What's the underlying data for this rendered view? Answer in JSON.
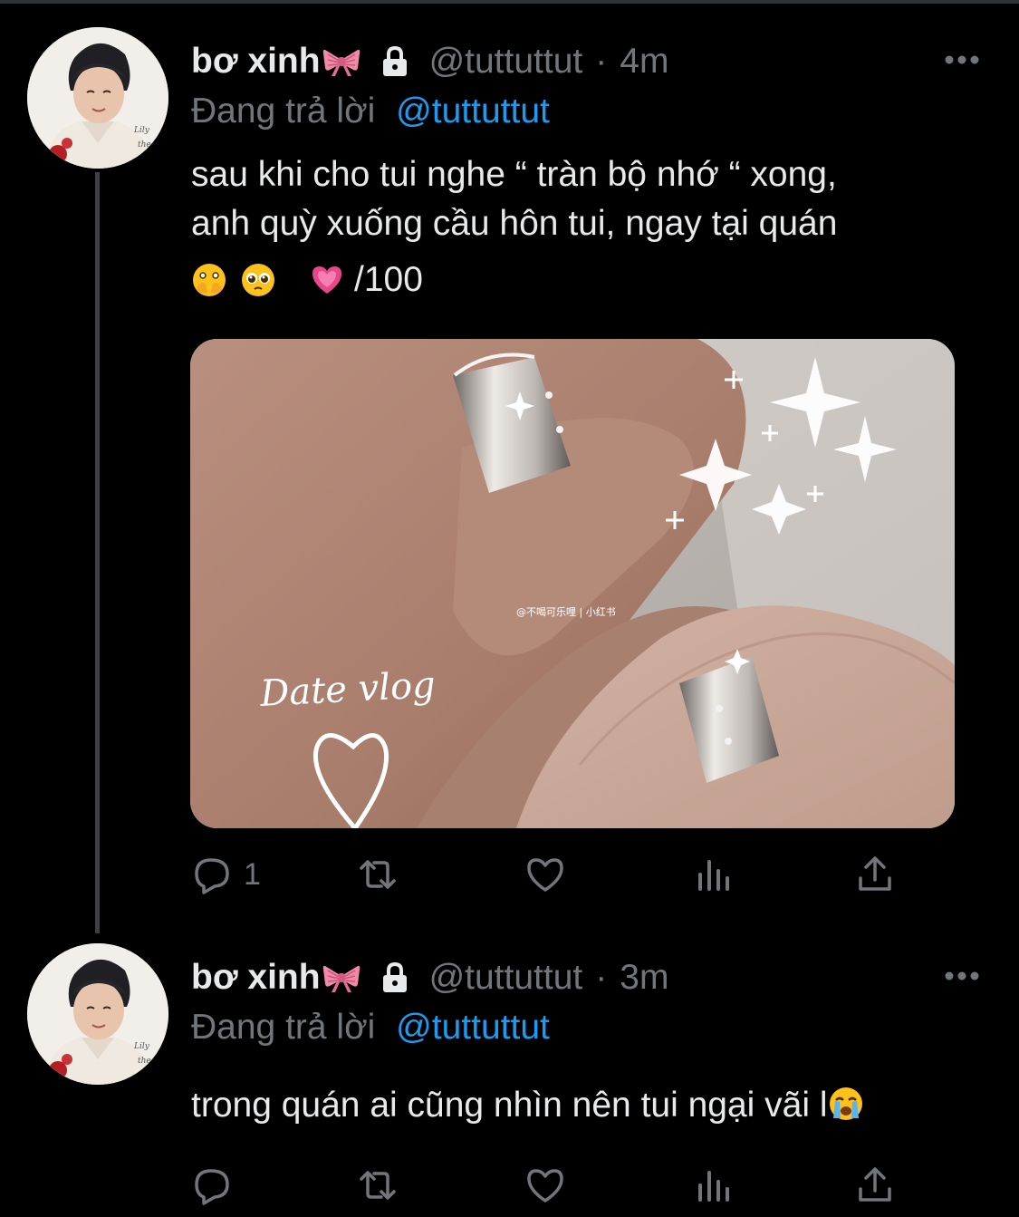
{
  "colors": {
    "background": "#000000",
    "text": "#e7e9ea",
    "muted": "#71767b",
    "link": "#1d9bf0",
    "thread_line": "#3e4144"
  },
  "tweets": [
    {
      "display_name": "bơ xinh",
      "name_icon": "ribbon-bow",
      "protected_icon": "lock-icon",
      "handle": "@tuttuttut",
      "separator": "·",
      "time": "4m",
      "reply_prefix": "Đang trả lời",
      "reply_to": "@tuttuttut",
      "text_lines": [
        "sau khi cho tui nghe “ tràn bộ nhớ “ xong,",
        "anh quỳ xuống cầu hôn tui, ngay tại quán"
      ],
      "emoji_suffix": "/100",
      "emojis": [
        "face-with-open-eyes-and-hand-over-mouth",
        "pleading-face",
        "growing-heart"
      ],
      "media": {
        "caption": "Date vlog",
        "watermark": "@不喝可乐哩 | 小红书"
      },
      "actions": {
        "reply_count": "1",
        "retweet_count": "",
        "like_count": "",
        "views_count": ""
      }
    },
    {
      "display_name": "bơ xinh",
      "name_icon": "ribbon-bow",
      "protected_icon": "lock-icon",
      "handle": "@tuttuttut",
      "separator": "·",
      "time": "3m",
      "reply_prefix": "Đang trả lời",
      "reply_to": "@tuttuttut",
      "text": "trong quán ai cũng nhìn nên tui ngại vãi l",
      "trailing_emoji": "loudly-crying-face",
      "actions": {
        "reply_count": "",
        "retweet_count": "",
        "like_count": "",
        "views_count": ""
      }
    }
  ]
}
